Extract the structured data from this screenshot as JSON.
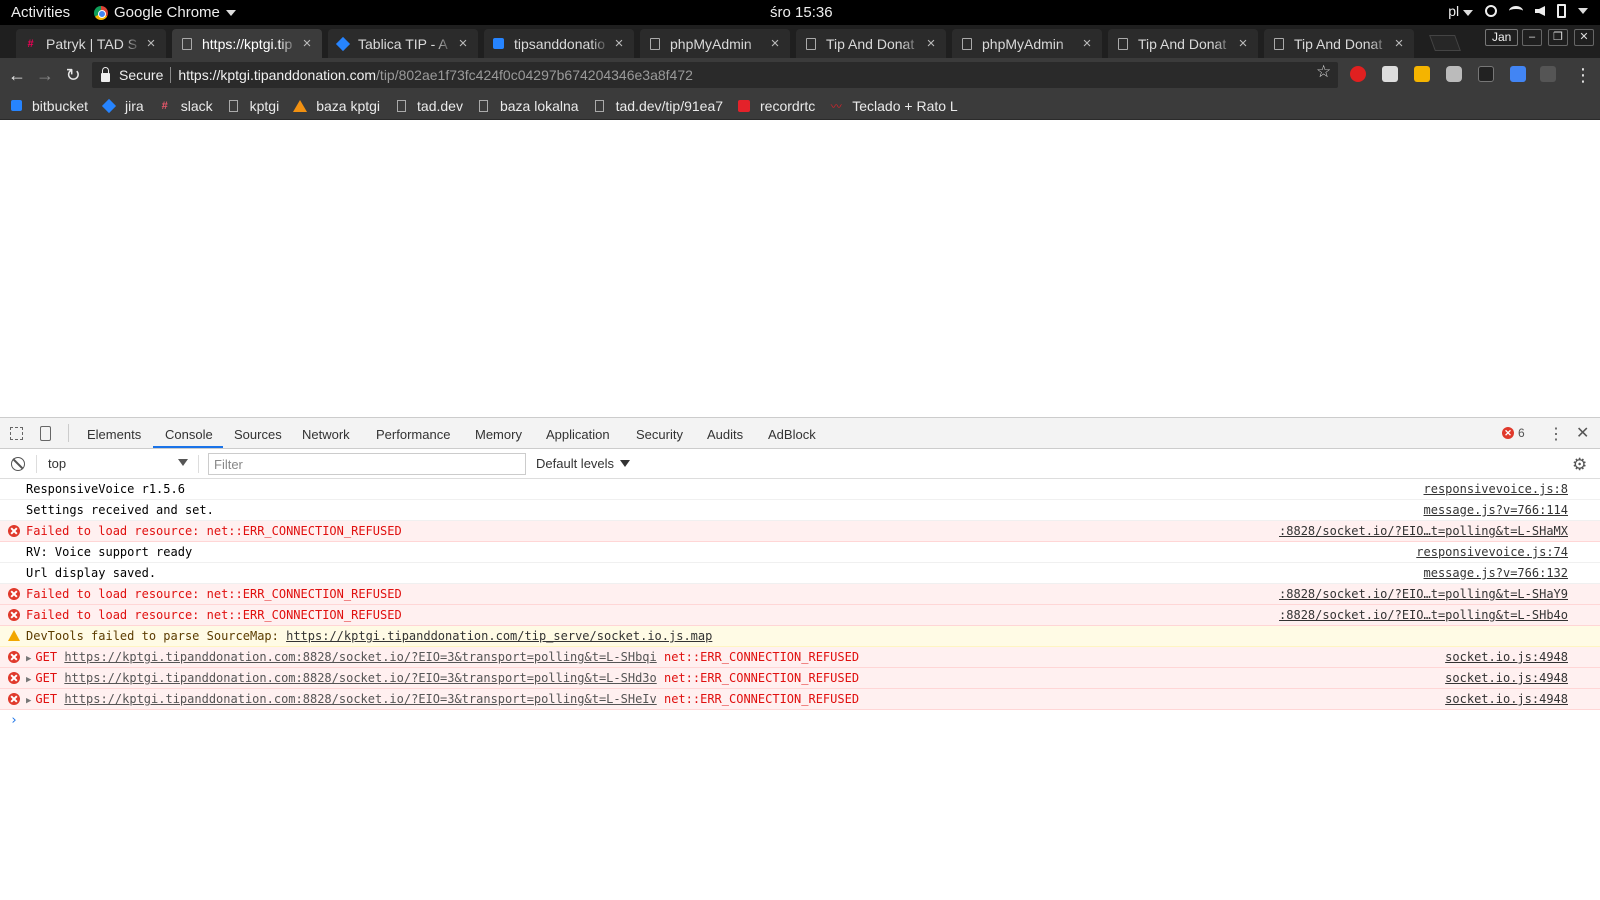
{
  "system_bar": {
    "activities": "Activities",
    "app_name": "Google Chrome",
    "clock": "śro 15:36",
    "language": "pl"
  },
  "tabs": [
    {
      "title": "Patryk | TAD S",
      "favicon": "slack-hash-icon"
    },
    {
      "title": "https://kptgi.tip",
      "favicon": "document-icon",
      "active": true
    },
    {
      "title": "Tablica TIP - A",
      "favicon": "jira-icon"
    },
    {
      "title": "tipsanddonatio",
      "favicon": "bitbucket-icon"
    },
    {
      "title": "phpMyAdmin",
      "favicon": "document-icon"
    },
    {
      "title": "Tip And Donat",
      "favicon": "document-icon"
    },
    {
      "title": "phpMyAdmin",
      "favicon": "document-icon"
    },
    {
      "title": "Tip And Donat",
      "favicon": "document-icon"
    },
    {
      "title": "Tip And Donat",
      "favicon": "document-icon"
    }
  ],
  "tab_close_glyph": "×",
  "profile_name": "Jan",
  "toolbar": {
    "secure_label": "Secure",
    "url_host": "https://kptgi.tipanddonation.com",
    "url_path": "/tip/802ae1f73fc424f0c04297b674204346e3a8f472"
  },
  "bookmarks": [
    {
      "label": "bitbucket",
      "icon": "bitbucket-icon"
    },
    {
      "label": "jira",
      "icon": "jira-icon"
    },
    {
      "label": "slack",
      "icon": "slack-hash-icon"
    },
    {
      "label": "kptgi",
      "icon": "document-icon"
    },
    {
      "label": "baza kptgi",
      "icon": "cone-icon"
    },
    {
      "label": "tad.dev",
      "icon": "document-icon"
    },
    {
      "label": "baza lokalna",
      "icon": "document-icon"
    },
    {
      "label": "tad.dev/tip/91ea7",
      "icon": "document-icon"
    },
    {
      "label": "recordrtc",
      "icon": "red-square-icon"
    },
    {
      "label": "Teclado + Rato L",
      "icon": "mouse-icon"
    }
  ],
  "devtools": {
    "tabs": [
      "Elements",
      "Console",
      "Sources",
      "Network",
      "Performance",
      "Memory",
      "Application",
      "Security",
      "Audits",
      "AdBlock"
    ],
    "active_tab": "Console",
    "error_count": "6",
    "context": "top",
    "filter_placeholder": "Filter",
    "levels_label": "Default levels"
  },
  "console": [
    {
      "type": "log",
      "text": "ResponsiveVoice r1.5.6",
      "source": "responsivevoice.js:8"
    },
    {
      "type": "log",
      "text": "Settings received and set.",
      "source": "message.js?v=766:114"
    },
    {
      "type": "error",
      "text": "Failed to load resource: net::ERR_CONNECTION_REFUSED",
      "source": ":8828/socket.io/?EIO…t=polling&t=L-SHaMX"
    },
    {
      "type": "log",
      "text": "RV: Voice support ready",
      "source": "responsivevoice.js:74"
    },
    {
      "type": "log",
      "text": "Url display saved.",
      "source": "message.js?v=766:132"
    },
    {
      "type": "error",
      "text": "Failed to load resource: net::ERR_CONNECTION_REFUSED",
      "source": ":8828/socket.io/?EIO…t=polling&t=L-SHaY9"
    },
    {
      "type": "error",
      "text": "Failed to load resource: net::ERR_CONNECTION_REFUSED",
      "source": ":8828/socket.io/?EIO…t=polling&t=L-SHb4o"
    },
    {
      "type": "warning",
      "text": "DevTools failed to parse SourceMap: ",
      "link": "https://kptgi.tipanddonation.com/tip_serve/socket.io.js.map",
      "source": ""
    },
    {
      "type": "error",
      "expand": true,
      "prefix": "GET ",
      "link": "https://kptgi.tipanddonation.com:8828/socket.io/?EIO=3&transport=polling&t=L-SHbqi",
      "suffix": " net::ERR_CONNECTION_REFUSED",
      "source": "socket.io.js:4948"
    },
    {
      "type": "error",
      "expand": true,
      "prefix": "GET ",
      "link": "https://kptgi.tipanddonation.com:8828/socket.io/?EIO=3&transport=polling&t=L-SHd3o",
      "suffix": " net::ERR_CONNECTION_REFUSED",
      "source": "socket.io.js:4948"
    },
    {
      "type": "error",
      "expand": true,
      "prefix": "GET ",
      "link": "https://kptgi.tipanddonation.com:8828/socket.io/?EIO=3&transport=polling&t=L-SHeIv",
      "suffix": " net::ERR_CONNECTION_REFUSED",
      "source": "socket.io.js:4948"
    }
  ],
  "prompt_glyph": "›"
}
